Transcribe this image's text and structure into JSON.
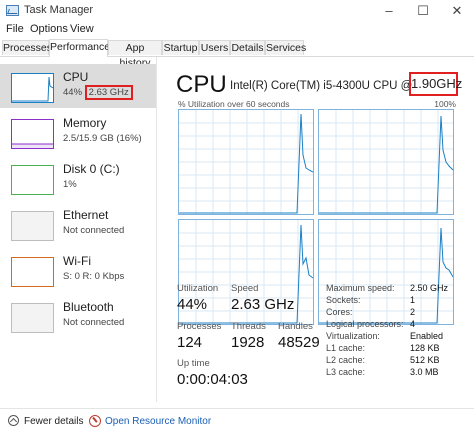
{
  "window": {
    "title": "Task Manager",
    "controls": {
      "minimize": "–",
      "maximize": "☐",
      "close": "✕"
    }
  },
  "menu": [
    "File",
    "Options",
    "View"
  ],
  "tabs": [
    "Processes",
    "Performance",
    "App history",
    "Startup",
    "Users",
    "Details",
    "Services"
  ],
  "active_tab": "Performance",
  "sidebar": {
    "items": [
      {
        "name": "CPU",
        "sub": "44%",
        "sub_highlight": "2.63 GHz",
        "color": "#1b7fc4"
      },
      {
        "name": "Memory",
        "sub": "2.5/15.9 GB (16%)",
        "color": "#8b2fc9"
      },
      {
        "name": "Disk 0 (C:)",
        "sub": "1%",
        "color": "#4caf50"
      },
      {
        "name": "Ethernet",
        "sub": "Not connected",
        "color": "#bdbdbd"
      },
      {
        "name": "Wi-Fi",
        "sub": "S: 0 R: 0 Kbps",
        "color": "#d2691e"
      },
      {
        "name": "Bluetooth",
        "sub": "Not connected",
        "color": "#bdbdbd"
      }
    ]
  },
  "main": {
    "title": "CPU",
    "model": "Intel(R) Core(TM) i5-4300U CPU @",
    "model_speed": "1.90GHz",
    "graph_label": "% Utilization over 60 seconds",
    "graph_max": "100%",
    "graph_color": "#1b7fc4",
    "stats": {
      "utilization_label": "Utilization",
      "utilization": "44%",
      "speed_label": "Speed",
      "speed": "2.63 GHz",
      "processes_label": "Processes",
      "processes": "124",
      "threads_label": "Threads",
      "threads": "1928",
      "handles_label": "Handles",
      "handles": "48529",
      "uptime_label": "Up time",
      "uptime": "0:00:04:03"
    },
    "info": [
      {
        "label": "Maximum speed:",
        "value": "2.50 GHz"
      },
      {
        "label": "Sockets:",
        "value": "1"
      },
      {
        "label": "Cores:",
        "value": "2"
      },
      {
        "label": "Logical processors:",
        "value": "4"
      },
      {
        "label": "Virtualization:",
        "value": "Enabled"
      },
      {
        "label": "L1 cache:",
        "value": "128 KB"
      },
      {
        "label": "L2 cache:",
        "value": "512 KB"
      },
      {
        "label": "L3 cache:",
        "value": "3.0 MB"
      }
    ]
  },
  "footer": {
    "fewer_details": "Fewer details",
    "open_monitor": "Open Resource Monitor"
  },
  "highlight_color": "#e02020"
}
